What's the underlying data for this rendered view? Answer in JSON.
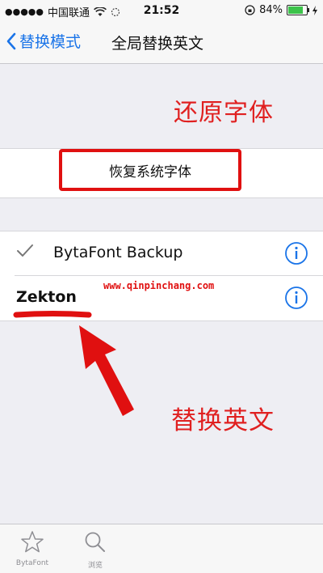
{
  "status_bar": {
    "carrier": "中国联通",
    "time": "21:52",
    "battery_percent": "84%",
    "battery_level": 0.84
  },
  "nav": {
    "back_label": "替换模式",
    "title": "全局替换英文"
  },
  "annotations": {
    "restore_hint": "还原字体",
    "replace_hint": "替换英文"
  },
  "restore_button_label": "恢复系统字体",
  "font_list": [
    {
      "name": "BytaFont Backup",
      "selected": true
    },
    {
      "name": "Zekton",
      "selected": false
    }
  ],
  "watermark": "www.qinpinchang.com",
  "tabs": [
    {
      "label": "BytaFont",
      "icon": "star-icon"
    },
    {
      "label": "浏览",
      "icon": "search-icon"
    }
  ],
  "colors": {
    "accent": "#1a74e8",
    "annotation_red": "#e02020",
    "battery_green": "#3cc34a"
  }
}
